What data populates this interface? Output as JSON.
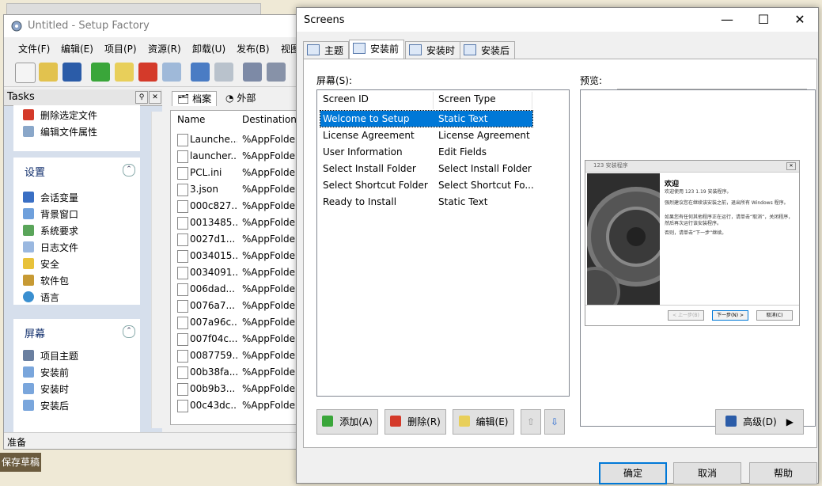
{
  "main_window": {
    "title": "Untitled - Setup Factory",
    "menu": [
      "文件(F)",
      "编辑(E)",
      "项目(P)",
      "资源(R)",
      "卸载(U)",
      "发布(B)",
      "视图"
    ],
    "tasks_title": "Tasks",
    "tasks_top_items": [
      "删除选定文件",
      "编辑文件属性"
    ],
    "settings_group": {
      "title": "设置",
      "items": [
        "会话变量",
        "背景窗口",
        "系统要求",
        "日志文件",
        "安全",
        "软件包",
        "语言"
      ]
    },
    "screens_group": {
      "title": "屏幕",
      "items": [
        "项目主题",
        "安装前",
        "安装时",
        "安装后"
      ]
    },
    "file_tabs": [
      "档案",
      "外部"
    ],
    "file_columns": [
      "Name",
      "Destination"
    ],
    "files": [
      {
        "name": "Launche...",
        "dest": "%AppFolder"
      },
      {
        "name": "launcher...",
        "dest": "%AppFolder"
      },
      {
        "name": "PCL.ini",
        "dest": "%AppFolder"
      },
      {
        "name": "3.json",
        "dest": "%AppFolder"
      },
      {
        "name": "000c827...",
        "dest": "%AppFolder"
      },
      {
        "name": "0013485...",
        "dest": "%AppFolder"
      },
      {
        "name": "0027d1...",
        "dest": "%AppFolder"
      },
      {
        "name": "0034015...",
        "dest": "%AppFolder"
      },
      {
        "name": "0034091...",
        "dest": "%AppFolder"
      },
      {
        "name": "006dad...",
        "dest": "%AppFolder"
      },
      {
        "name": "0076a7...",
        "dest": "%AppFolder"
      },
      {
        "name": "007a96c...",
        "dest": "%AppFolder"
      },
      {
        "name": "007f04c...",
        "dest": "%AppFolder"
      },
      {
        "name": "0087759...",
        "dest": "%AppFolder"
      },
      {
        "name": "00b38fa...",
        "dest": "%AppFolder"
      },
      {
        "name": "00b9b3...",
        "dest": "%AppFolder"
      },
      {
        "name": "00c43dc...",
        "dest": "%AppFolder"
      }
    ],
    "status": "准备"
  },
  "background": {
    "draft_button": "保存草稿"
  },
  "dialog": {
    "title": "Screens",
    "controls": {
      "minimize": "—",
      "maximize": "☐",
      "close": "✕"
    },
    "tabs": [
      "主题",
      "安装前",
      "安装时",
      "安装后"
    ],
    "active_tab": "安装前",
    "screens_label": "屏幕(S):",
    "preview_label": "预览:",
    "list_columns": [
      "Screen ID",
      "Screen Type"
    ],
    "screens": [
      {
        "id": "Welcome to Setup",
        "type": "Static Text",
        "selected": true
      },
      {
        "id": "License Agreement",
        "type": "License Agreement"
      },
      {
        "id": "User Information",
        "type": "Edit Fields"
      },
      {
        "id": "Select Install Folder",
        "type": "Select Install Folder"
      },
      {
        "id": "Select Shortcut Folder",
        "type": "Select Shortcut Fo..."
      },
      {
        "id": "Ready to Install",
        "type": "Static Text"
      }
    ],
    "preview": {
      "window_title": "123 安装程序",
      "heading": "欢迎",
      "lines": [
        "欢迎使用 123 1.19 安装程序。",
        "强烈建议您在继续该安装之前，退出所有 Windows 程序。",
        "如果您有任何其他程序正在运行，请单击“取消”，关闭程序，然后再次运行该安装程序。",
        "否则，请单击“下一步”继续。"
      ],
      "btn_back": "< 上一步(B)",
      "btn_next": "下一步(N) >",
      "btn_cancel": "取消(C)"
    },
    "buttons": {
      "add": "添加(A)",
      "delete": "删除(R)",
      "edit": "编辑(E)",
      "up": "⇧",
      "down": "⇩",
      "advanced": "高级(D)",
      "advanced_arrow": "▶",
      "ok": "确定",
      "cancel": "取消",
      "help": "帮助"
    }
  },
  "colors": {
    "selection": "#0078d7",
    "tasks_panel": "#d6dfec",
    "group_title": "#0f2d6b"
  }
}
